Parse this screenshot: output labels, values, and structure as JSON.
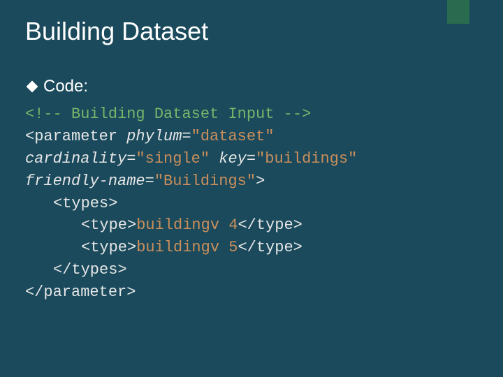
{
  "title": "Building Dataset",
  "bullet": "Code:",
  "code": {
    "comment_open": "<!-- ",
    "comment_text": "Building Dataset Input",
    "comment_close": " -->",
    "param_open": "<parameter",
    "attr_phylum_name": "phylum",
    "attr_phylum_val": "\"dataset\"",
    "attr_cardinality_name": "cardinality",
    "attr_cardinality_val": "\"single\"",
    "attr_key_name": "key",
    "attr_key_val": "\"buildings\"",
    "attr_friendly_name": "friendly-name",
    "attr_friendly_val": "\"Buildings\"",
    "param_open_close": ">",
    "types_open": "<types>",
    "type_open": "<type>",
    "type1_text": "buildingv 4",
    "type2_text": "buildingv 5",
    "type_close": "</type>",
    "types_close": "</types>",
    "param_close": "</parameter>"
  }
}
